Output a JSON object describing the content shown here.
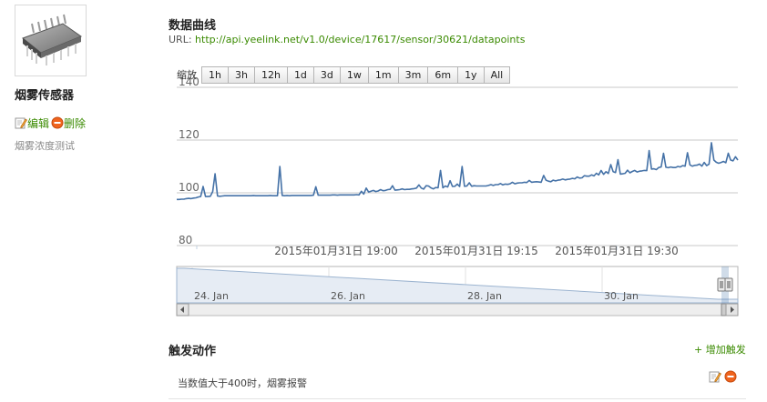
{
  "device": {
    "name": "烟雾传感器",
    "edit_label": "编辑",
    "delete_label": "删除",
    "description": "烟雾浓度测试"
  },
  "data_section": {
    "title": "数据曲线",
    "url_prefix": "URL: ",
    "url": "http://api.yeelink.net/v1.0/device/17617/sensor/30621/datapoints"
  },
  "zoom": {
    "label": "缩放",
    "buttons": [
      "1h",
      "3h",
      "12h",
      "1d",
      "3d",
      "1w",
      "1m",
      "3m",
      "6m",
      "1y",
      "All"
    ]
  },
  "chart_data": {
    "type": "line",
    "ylim": [
      80,
      140
    ],
    "y_ticks": [
      "140",
      "120",
      "100",
      "80"
    ],
    "x_tick_labels": [
      "2015年01月31日 19:00",
      "2015年01月31日 19:15",
      "2015年01月31日 19:30"
    ],
    "grid": true,
    "series": [
      {
        "values": [
          97.5,
          97.5,
          97.6,
          97.6,
          97.8,
          97.9,
          97.8,
          98.0,
          98.1,
          98.4,
          98.6,
          102.4,
          98.6,
          98.6,
          98.7,
          100.5,
          107.2,
          98.8,
          98.7,
          98.8,
          98.9,
          98.9,
          98.9,
          98.9,
          98.9,
          98.9,
          98.9,
          98.9,
          98.9,
          98.9,
          98.9,
          98.9,
          99.0,
          98.9,
          98.9,
          98.9,
          98.9,
          98.9,
          98.9,
          99.0,
          98.9,
          98.9,
          98.9,
          110.0,
          99.0,
          98.9,
          99.0,
          98.9,
          99.0,
          99.0,
          99.0,
          99.0,
          99.0,
          99.0,
          99.0,
          99.0,
          99.0,
          99.1,
          102.3,
          99.1,
          99.1,
          99.1,
          99.1,
          99.1,
          99.1,
          99.2,
          99.2,
          99.1,
          99.2,
          99.2,
          99.2,
          99.2,
          99.2,
          99.2,
          99.2,
          99.3,
          99.2,
          100.6,
          99.5,
          101.8,
          100.3,
          100.6,
          100.9,
          100.5,
          100.7,
          101.2,
          100.8,
          100.9,
          101.2,
          101.3,
          102.7,
          101.0,
          101.1,
          101.2,
          101.5,
          101.2,
          101.3,
          101.3,
          101.5,
          101.6,
          101.8,
          103.0,
          101.8,
          101.4,
          102.7,
          102.6,
          101.9,
          101.5,
          102.0,
          101.9,
          108.5,
          101.9,
          102.6,
          102.2,
          104.6,
          102.4,
          102.5,
          103.3,
          102.4,
          110.0,
          102.5,
          102.6,
          103.8,
          102.5,
          102.7,
          102.6,
          102.6,
          102.6,
          102.6,
          102.6,
          102.8,
          103.1,
          102.8,
          103.1,
          103.1,
          103.5,
          103.0,
          103.3,
          103.2,
          103.4,
          104.0,
          103.4,
          103.7,
          103.8,
          103.8,
          104.0,
          103.9,
          104.7,
          104.0,
          104.1,
          104.2,
          104.1,
          104.0,
          106.6,
          104.8,
          104.4,
          104.2,
          104.8,
          104.5,
          104.8,
          104.9,
          105.2,
          104.9,
          105.1,
          105.2,
          105.5,
          105.3,
          106.0,
          105.6,
          105.7,
          106.5,
          106.3,
          106.3,
          106.8,
          106.4,
          107.4,
          106.8,
          108.5,
          107.0,
          108.0,
          107.3,
          110.7,
          108.0,
          107.7,
          112.6,
          107.1,
          107.2,
          107.4,
          108.6,
          107.6,
          108.1,
          108.5,
          107.9,
          108.2,
          108.3,
          108.5,
          108.4,
          116.0,
          109.0,
          109.1,
          108.8,
          109.6,
          109.8,
          115.0,
          109.7,
          109.5,
          109.8,
          109.6,
          109.6,
          110.0,
          109.8,
          110.3,
          110.1,
          115.2,
          110.6,
          110.1,
          110.4,
          110.5,
          110.9,
          110.1,
          111.5,
          110.3,
          110.9,
          119.0,
          112.4,
          111.6,
          111.2,
          111.5,
          111.9,
          111.4,
          115.0,
          112.4,
          112.1,
          113.7,
          112.4
        ]
      }
    ],
    "navigator": {
      "x_tick_labels": [
        "24. Jan",
        "26. Jan",
        "28. Jan",
        "30. Jan"
      ]
    }
  },
  "triggers": {
    "title": "触发动作",
    "add_label": "+ 增加触发",
    "items": [
      {
        "text": "当数值大于400时，烟雾报警"
      }
    ]
  },
  "colors": {
    "accent_green": "#3a8a00",
    "line_blue": "#4572a7",
    "delete_orange": "#f0641e"
  }
}
